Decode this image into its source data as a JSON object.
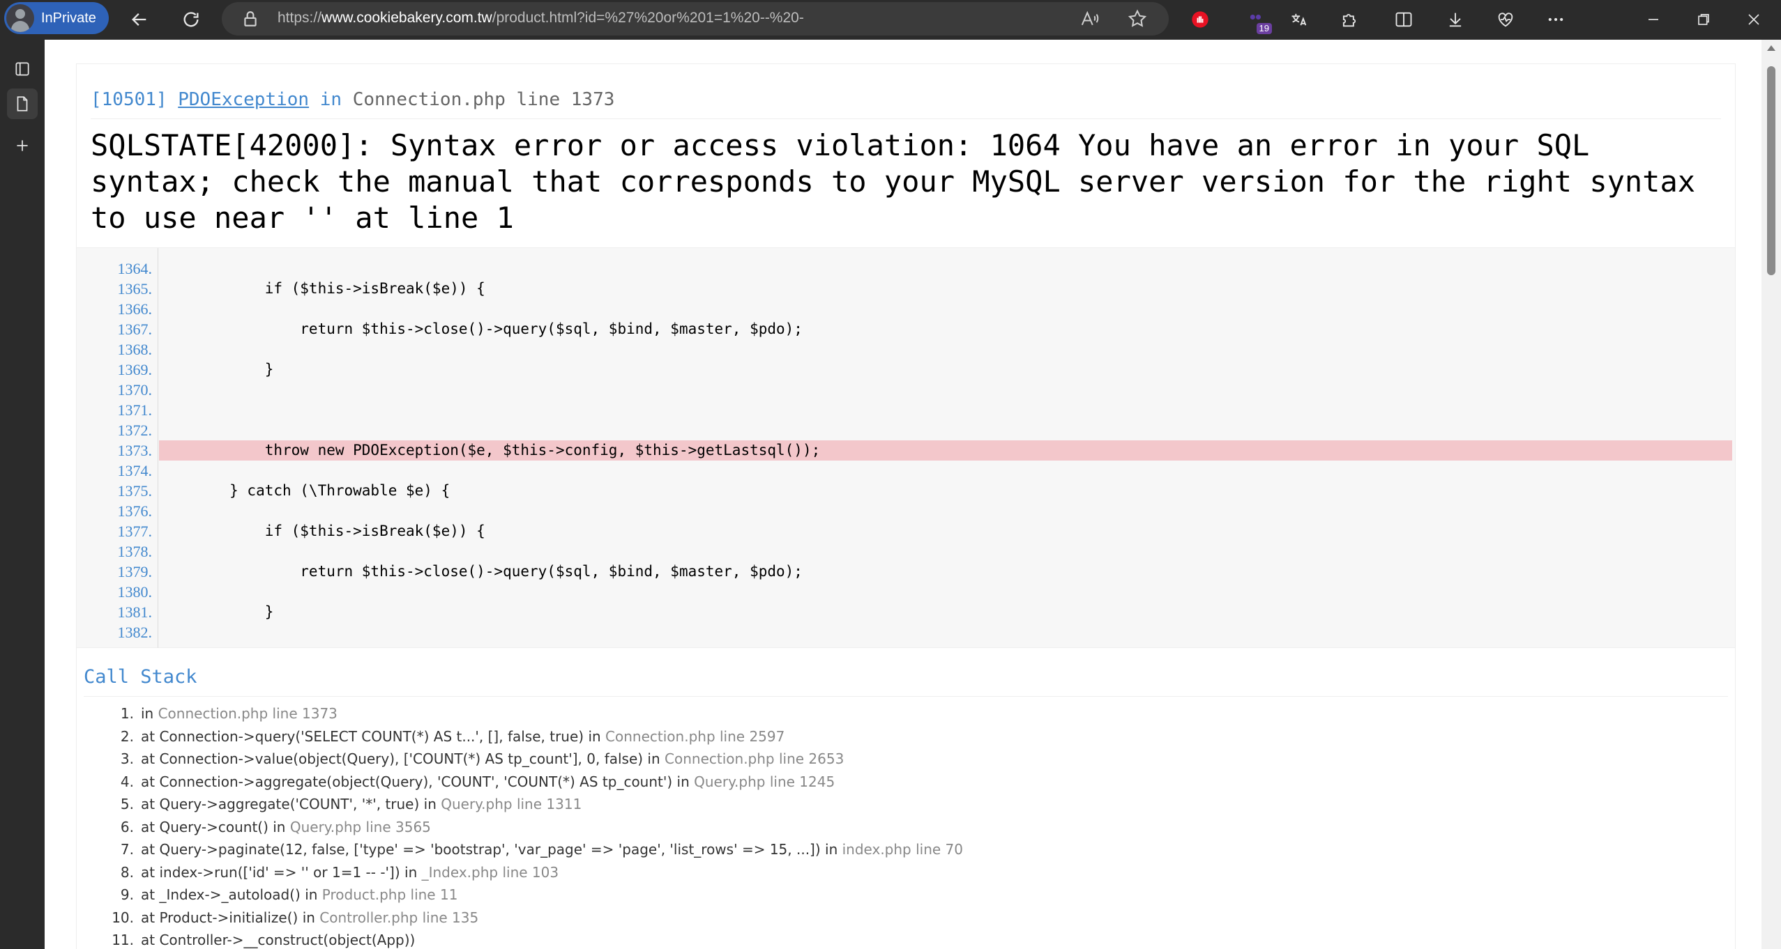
{
  "browser": {
    "inprivate_label": "InPrivate",
    "url_prefix": "https://",
    "url_host": "www.cookiebakery.com.tw",
    "url_path": "/product.html?id=%27%20or%201=1%20--%20-",
    "extension_badge": "19"
  },
  "exception": {
    "code": "[10501]",
    "class": "PDOException",
    "in_word": "in",
    "location": "Connection.php line 1373",
    "message": "SQLSTATE[42000]: Syntax error or access violation: 1064 You have an error in your SQL syntax; check the manual that corresponds to your MySQL server version for the right syntax to use near '' at line 1"
  },
  "source": {
    "highlight_line": "1373.",
    "lines": [
      {
        "num": "1364.",
        "code": ""
      },
      {
        "num": "1365.",
        "code": "            if ($this->isBreak($e)) {"
      },
      {
        "num": "1366.",
        "code": ""
      },
      {
        "num": "1367.",
        "code": "                return $this->close()->query($sql, $bind, $master, $pdo);"
      },
      {
        "num": "1368.",
        "code": ""
      },
      {
        "num": "1369.",
        "code": "            }"
      },
      {
        "num": "1370.",
        "code": ""
      },
      {
        "num": "1371.",
        "code": ""
      },
      {
        "num": "1372.",
        "code": ""
      },
      {
        "num": "1373.",
        "code": "            throw new PDOException($e, $this->config, $this->getLastsql());"
      },
      {
        "num": "1374.",
        "code": ""
      },
      {
        "num": "1375.",
        "code": "        } catch (\\Throwable $e) {"
      },
      {
        "num": "1376.",
        "code": ""
      },
      {
        "num": "1377.",
        "code": "            if ($this->isBreak($e)) {"
      },
      {
        "num": "1378.",
        "code": ""
      },
      {
        "num": "1379.",
        "code": "                return $this->close()->query($sql, $bind, $master, $pdo);"
      },
      {
        "num": "1380.",
        "code": ""
      },
      {
        "num": "1381.",
        "code": "            }"
      },
      {
        "num": "1382.",
        "code": ""
      }
    ]
  },
  "call_stack": {
    "title": "Call Stack",
    "items": [
      {
        "num": "1.",
        "text": "in ",
        "file": "Connection.php line 1373"
      },
      {
        "num": "2.",
        "text": "at Connection->query('SELECT COUNT(*) AS t...', [], false, true) in ",
        "file": "Connection.php line 2597"
      },
      {
        "num": "3.",
        "text": "at Connection->value(object(Query), ['COUNT(*) AS tp_count'], 0, false) in ",
        "file": "Connection.php line 2653"
      },
      {
        "num": "4.",
        "text": "at Connection->aggregate(object(Query), 'COUNT', 'COUNT(*) AS tp_count') in ",
        "file": "Query.php line 1245"
      },
      {
        "num": "5.",
        "text": "at Query->aggregate('COUNT', '*', true) in ",
        "file": "Query.php line 1311"
      },
      {
        "num": "6.",
        "text": "at Query->count() in ",
        "file": "Query.php line 3565"
      },
      {
        "num": "7.",
        "text": "at Query->paginate(12, false, ['type' => 'bootstrap', 'var_page' => 'page', 'list_rows' => 15, ...]) in ",
        "file": "index.php line 70"
      },
      {
        "num": "8.",
        "text": "at index->run(['id' => '' or 1=1 -- -']) in ",
        "file": "_Index.php line 103"
      },
      {
        "num": "9.",
        "text": "at _Index->_autoload() in ",
        "file": "Product.php line 11"
      },
      {
        "num": "10.",
        "text": "at Product->initialize() in ",
        "file": "Controller.php line 135"
      },
      {
        "num": "11.",
        "text": "at Controller->__construct(object(App))",
        "file": ""
      }
    ]
  },
  "colors": {
    "accent": "#4288ce",
    "highlight": "#f3c7cb",
    "chrome": "#2b2b2b"
  }
}
